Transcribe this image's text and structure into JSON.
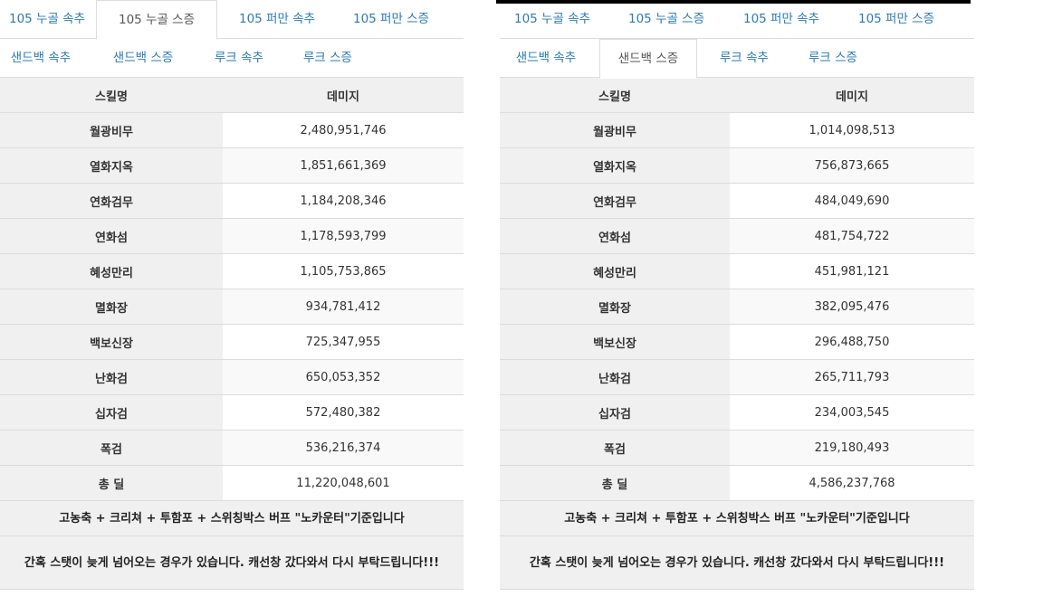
{
  "left": {
    "tabs_row1": [
      "105 누골 속추",
      "105 누골 스증",
      "105 퍼만 속추",
      "105 퍼만 스증"
    ],
    "tabs_row2": [
      "샌드백 속추",
      "샌드백 스증",
      "루크 속추",
      "루크 스증"
    ],
    "active_tab": "105 누골 스증",
    "header": {
      "skill": "스킬명",
      "damage": "데미지"
    },
    "rows": [
      {
        "skill": "월광비무",
        "damage": "2,480,951,746"
      },
      {
        "skill": "열화지옥",
        "damage": "1,851,661,369"
      },
      {
        "skill": "연화검무",
        "damage": "1,184,208,346"
      },
      {
        "skill": "연화섬",
        "damage": "1,178,593,799"
      },
      {
        "skill": "혜성만리",
        "damage": "1,105,753,865"
      },
      {
        "skill": "멸화장",
        "damage": "934,781,412"
      },
      {
        "skill": "백보신장",
        "damage": "725,347,955"
      },
      {
        "skill": "난화검",
        "damage": "650,053,352"
      },
      {
        "skill": "십자검",
        "damage": "572,480,382"
      },
      {
        "skill": "폭검",
        "damage": "536,216,374"
      },
      {
        "skill": "총 딜",
        "damage": "11,220,048,601"
      }
    ],
    "note1": "고농축 + 크리쳐 + 투함포 + 스위칭박스 버프 \"노카운터\"기준입니다",
    "note2": "간혹 스탯이 늦게 넘어오는 경우가 있습니다. 캐선창 갔다와서 다시 부탁드립니다!!!"
  },
  "right": {
    "tabs_row1": [
      "105 누골 속추",
      "105 누골 스증",
      "105 퍼만 속추",
      "105 퍼만 스증"
    ],
    "tabs_row2": [
      "샌드백 속추",
      "샌드백 스증",
      "루크 속추",
      "루크 스증"
    ],
    "active_tab": "샌드백 스증",
    "header": {
      "skill": "스킬명",
      "damage": "데미지"
    },
    "rows": [
      {
        "skill": "월광비무",
        "damage": "1,014,098,513"
      },
      {
        "skill": "열화지옥",
        "damage": "756,873,665"
      },
      {
        "skill": "연화검무",
        "damage": "484,049,690"
      },
      {
        "skill": "연화섬",
        "damage": "481,754,722"
      },
      {
        "skill": "혜성만리",
        "damage": "451,981,121"
      },
      {
        "skill": "멸화장",
        "damage": "382,095,476"
      },
      {
        "skill": "백보신장",
        "damage": "296,488,750"
      },
      {
        "skill": "난화검",
        "damage": "265,711,793"
      },
      {
        "skill": "십자검",
        "damage": "234,003,545"
      },
      {
        "skill": "폭검",
        "damage": "219,180,493"
      },
      {
        "skill": "총 딜",
        "damage": "4,586,237,768"
      }
    ],
    "note1": "고농축 + 크리쳐 + 투함포 + 스위칭박스 버프 \"노카운터\"기준입니다",
    "note2": "간혹 스탯이 늦게 넘어오는 경우가 있습니다. 캐선창 갔다와서 다시 부탁드립니다!!!"
  }
}
